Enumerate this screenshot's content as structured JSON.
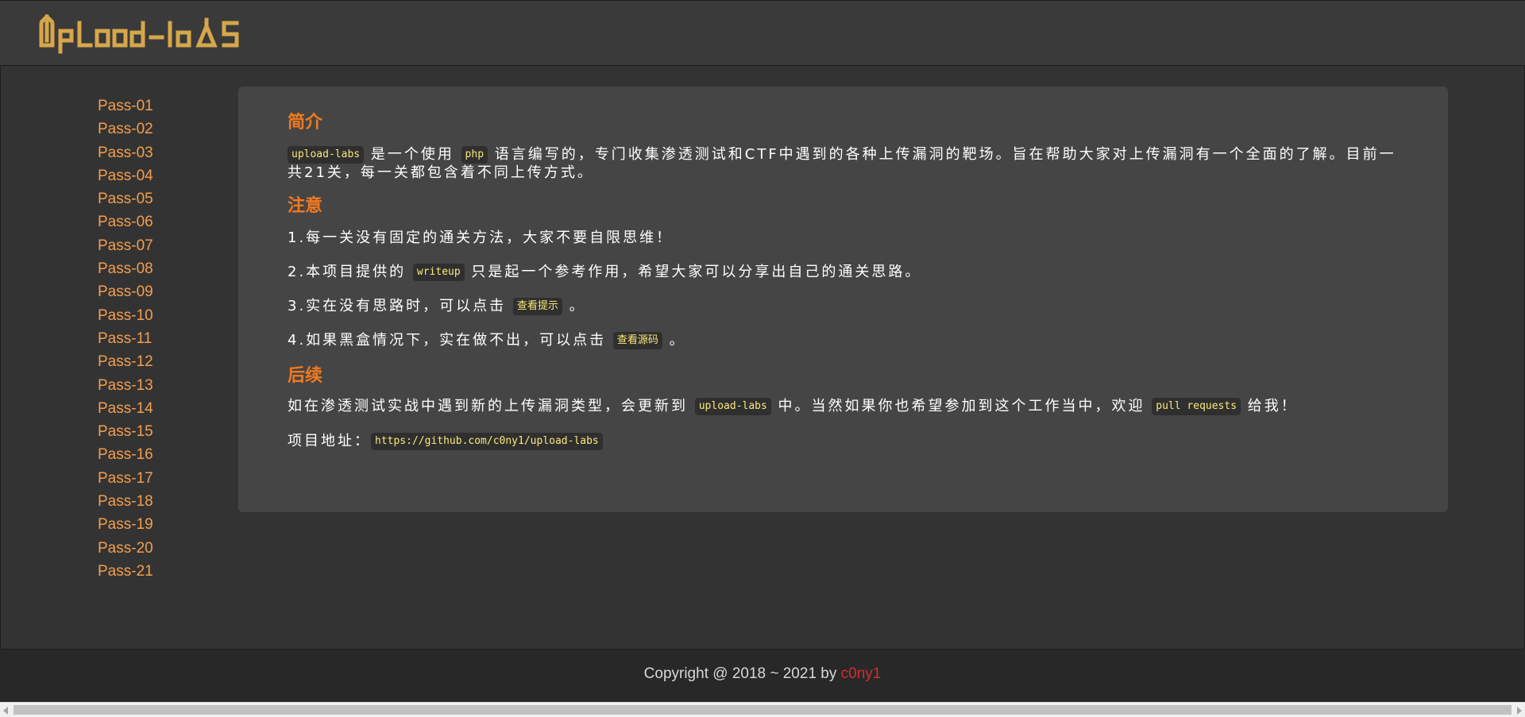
{
  "sidebar": {
    "items": [
      "Pass-01",
      "Pass-02",
      "Pass-03",
      "Pass-04",
      "Pass-05",
      "Pass-06",
      "Pass-07",
      "Pass-08",
      "Pass-09",
      "Pass-10",
      "Pass-11",
      "Pass-12",
      "Pass-13",
      "Pass-14",
      "Pass-15",
      "Pass-16",
      "Pass-17",
      "Pass-18",
      "Pass-19",
      "Pass-20",
      "Pass-21"
    ]
  },
  "content": {
    "intro": {
      "heading": "简介",
      "code1": "upload-labs",
      "text1": " 是一个使用 ",
      "code2": "php",
      "text2": " 语言编写的，专门收集渗透测试和CTF中遇到的各种上传漏洞的靶场。旨在帮助大家对上传漏洞有一个全面的了解。目前一共21关，每一关都包含着不同上传方式。"
    },
    "notes": {
      "heading": "注意",
      "note1": "1.每一关没有固定的通关方法，大家不要自限思维！",
      "note2_pre": "2.本项目提供的 ",
      "note2_code": "writeup",
      "note2_post": " 只是起一个参考作用，希望大家可以分享出自己的通关思路。",
      "note3_pre": "3.实在没有思路时，可以点击 ",
      "note3_button": "查看提示",
      "note3_post": " 。",
      "note4_pre": "4.如果黑盒情况下，实在做不出，可以点击 ",
      "note4_button": "查看源码",
      "note4_post": " 。"
    },
    "follow": {
      "heading": "后续",
      "text_pre": "如在渗透测试实战中遇到新的上传漏洞类型，会更新到 ",
      "code1": "upload-labs",
      "text_mid": " 中。当然如果你也希望参加到这个工作当中，欢迎 ",
      "code2": "pull requests",
      "text_post": " 给我！",
      "address_label": "项目地址：",
      "address_url": "https://github.com/c0ny1/upload-labs"
    }
  },
  "footer": {
    "text": "Copyright @ 2018 ~ 2021 by ",
    "author": "c0ny1",
    "author_color": "#d22e2e"
  },
  "colors": {
    "link": "#f39e4f",
    "heading": "#f27a1f",
    "code_text": "#fbe87a",
    "logo": "#d6a74a"
  }
}
